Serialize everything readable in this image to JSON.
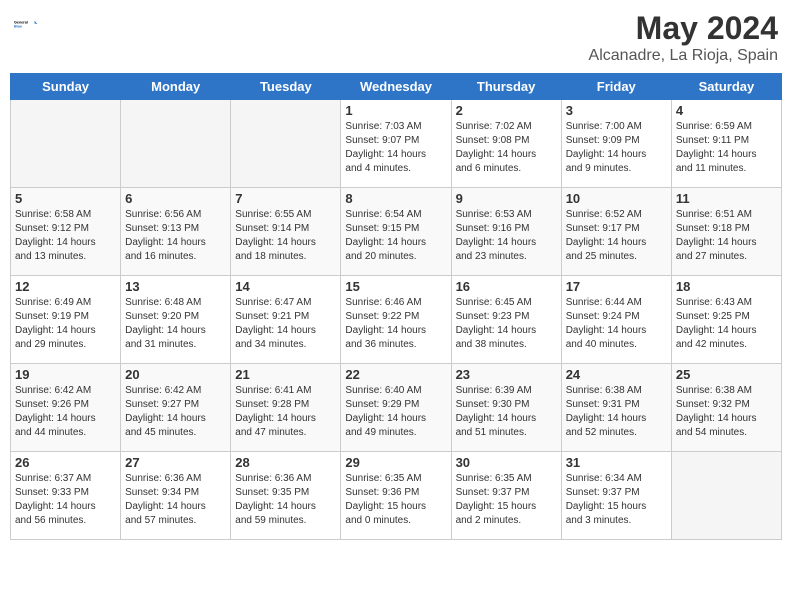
{
  "header": {
    "logo_line1": "General",
    "logo_line2": "Blue",
    "month": "May 2024",
    "location": "Alcanadre, La Rioja, Spain"
  },
  "weekdays": [
    "Sunday",
    "Monday",
    "Tuesday",
    "Wednesday",
    "Thursday",
    "Friday",
    "Saturday"
  ],
  "weeks": [
    [
      {
        "day": "",
        "info": ""
      },
      {
        "day": "",
        "info": ""
      },
      {
        "day": "",
        "info": ""
      },
      {
        "day": "1",
        "info": "Sunrise: 7:03 AM\nSunset: 9:07 PM\nDaylight: 14 hours\nand 4 minutes."
      },
      {
        "day": "2",
        "info": "Sunrise: 7:02 AM\nSunset: 9:08 PM\nDaylight: 14 hours\nand 6 minutes."
      },
      {
        "day": "3",
        "info": "Sunrise: 7:00 AM\nSunset: 9:09 PM\nDaylight: 14 hours\nand 9 minutes."
      },
      {
        "day": "4",
        "info": "Sunrise: 6:59 AM\nSunset: 9:11 PM\nDaylight: 14 hours\nand 11 minutes."
      }
    ],
    [
      {
        "day": "5",
        "info": "Sunrise: 6:58 AM\nSunset: 9:12 PM\nDaylight: 14 hours\nand 13 minutes."
      },
      {
        "day": "6",
        "info": "Sunrise: 6:56 AM\nSunset: 9:13 PM\nDaylight: 14 hours\nand 16 minutes."
      },
      {
        "day": "7",
        "info": "Sunrise: 6:55 AM\nSunset: 9:14 PM\nDaylight: 14 hours\nand 18 minutes."
      },
      {
        "day": "8",
        "info": "Sunrise: 6:54 AM\nSunset: 9:15 PM\nDaylight: 14 hours\nand 20 minutes."
      },
      {
        "day": "9",
        "info": "Sunrise: 6:53 AM\nSunset: 9:16 PM\nDaylight: 14 hours\nand 23 minutes."
      },
      {
        "day": "10",
        "info": "Sunrise: 6:52 AM\nSunset: 9:17 PM\nDaylight: 14 hours\nand 25 minutes."
      },
      {
        "day": "11",
        "info": "Sunrise: 6:51 AM\nSunset: 9:18 PM\nDaylight: 14 hours\nand 27 minutes."
      }
    ],
    [
      {
        "day": "12",
        "info": "Sunrise: 6:49 AM\nSunset: 9:19 PM\nDaylight: 14 hours\nand 29 minutes."
      },
      {
        "day": "13",
        "info": "Sunrise: 6:48 AM\nSunset: 9:20 PM\nDaylight: 14 hours\nand 31 minutes."
      },
      {
        "day": "14",
        "info": "Sunrise: 6:47 AM\nSunset: 9:21 PM\nDaylight: 14 hours\nand 34 minutes."
      },
      {
        "day": "15",
        "info": "Sunrise: 6:46 AM\nSunset: 9:22 PM\nDaylight: 14 hours\nand 36 minutes."
      },
      {
        "day": "16",
        "info": "Sunrise: 6:45 AM\nSunset: 9:23 PM\nDaylight: 14 hours\nand 38 minutes."
      },
      {
        "day": "17",
        "info": "Sunrise: 6:44 AM\nSunset: 9:24 PM\nDaylight: 14 hours\nand 40 minutes."
      },
      {
        "day": "18",
        "info": "Sunrise: 6:43 AM\nSunset: 9:25 PM\nDaylight: 14 hours\nand 42 minutes."
      }
    ],
    [
      {
        "day": "19",
        "info": "Sunrise: 6:42 AM\nSunset: 9:26 PM\nDaylight: 14 hours\nand 44 minutes."
      },
      {
        "day": "20",
        "info": "Sunrise: 6:42 AM\nSunset: 9:27 PM\nDaylight: 14 hours\nand 45 minutes."
      },
      {
        "day": "21",
        "info": "Sunrise: 6:41 AM\nSunset: 9:28 PM\nDaylight: 14 hours\nand 47 minutes."
      },
      {
        "day": "22",
        "info": "Sunrise: 6:40 AM\nSunset: 9:29 PM\nDaylight: 14 hours\nand 49 minutes."
      },
      {
        "day": "23",
        "info": "Sunrise: 6:39 AM\nSunset: 9:30 PM\nDaylight: 14 hours\nand 51 minutes."
      },
      {
        "day": "24",
        "info": "Sunrise: 6:38 AM\nSunset: 9:31 PM\nDaylight: 14 hours\nand 52 minutes."
      },
      {
        "day": "25",
        "info": "Sunrise: 6:38 AM\nSunset: 9:32 PM\nDaylight: 14 hours\nand 54 minutes."
      }
    ],
    [
      {
        "day": "26",
        "info": "Sunrise: 6:37 AM\nSunset: 9:33 PM\nDaylight: 14 hours\nand 56 minutes."
      },
      {
        "day": "27",
        "info": "Sunrise: 6:36 AM\nSunset: 9:34 PM\nDaylight: 14 hours\nand 57 minutes."
      },
      {
        "day": "28",
        "info": "Sunrise: 6:36 AM\nSunset: 9:35 PM\nDaylight: 14 hours\nand 59 minutes."
      },
      {
        "day": "29",
        "info": "Sunrise: 6:35 AM\nSunset: 9:36 PM\nDaylight: 15 hours\nand 0 minutes."
      },
      {
        "day": "30",
        "info": "Sunrise: 6:35 AM\nSunset: 9:37 PM\nDaylight: 15 hours\nand 2 minutes."
      },
      {
        "day": "31",
        "info": "Sunrise: 6:34 AM\nSunset: 9:37 PM\nDaylight: 15 hours\nand 3 minutes."
      },
      {
        "day": "",
        "info": ""
      }
    ]
  ]
}
